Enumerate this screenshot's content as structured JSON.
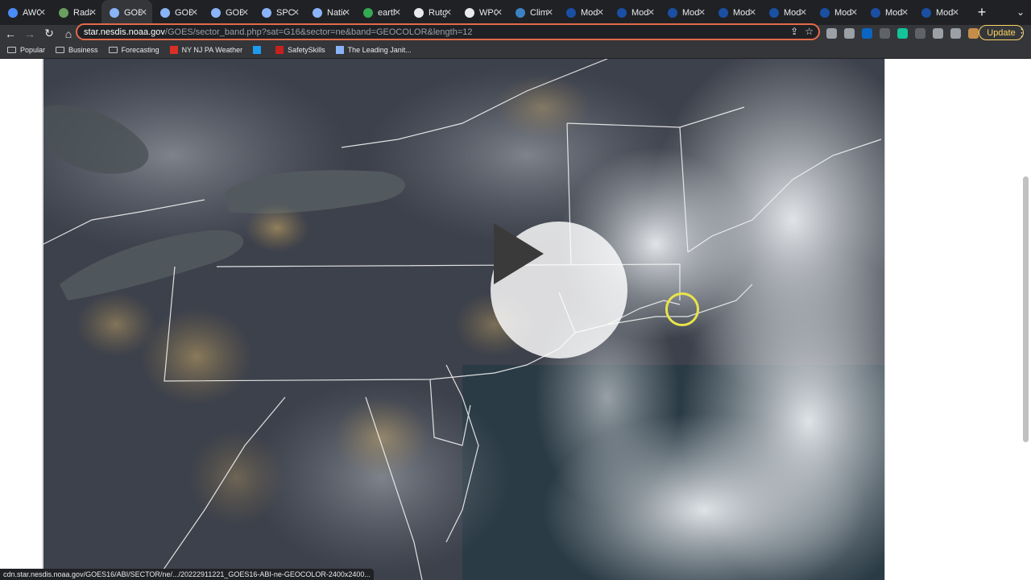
{
  "tabs": [
    {
      "label": "AWC",
      "color": "#4a8cf7"
    },
    {
      "label": "Rada",
      "color": "#6a9f5f"
    },
    {
      "label": "GOES",
      "color": "#8ab4f8",
      "active": true
    },
    {
      "label": "GOES",
      "color": "#8ab4f8"
    },
    {
      "label": "GOES",
      "color": "#8ab4f8"
    },
    {
      "label": "SPC",
      "color": "#8ab4f8"
    },
    {
      "label": "Natio",
      "color": "#8ab4f8"
    },
    {
      "label": "earth",
      "color": "#34a853"
    },
    {
      "label": "Rutge",
      "color": "#e8eaed"
    },
    {
      "label": "WPC",
      "color": "#e8eaed"
    },
    {
      "label": "Clima",
      "color": "#3b82c4"
    },
    {
      "label": "Mode",
      "color": "#1a4fa3"
    },
    {
      "label": "Mode",
      "color": "#1a4fa3"
    },
    {
      "label": "Mode",
      "color": "#1a4fa3"
    },
    {
      "label": "Mode",
      "color": "#1a4fa3"
    },
    {
      "label": "Mode",
      "color": "#1a4fa3"
    },
    {
      "label": "Mode",
      "color": "#1a4fa3"
    },
    {
      "label": "Mode",
      "color": "#1a4fa3"
    },
    {
      "label": "Mode",
      "color": "#1a4fa3"
    }
  ],
  "newtab_glyph": "+",
  "tabmenu_glyph": "⌄",
  "close_glyph": "✕",
  "nav": {
    "back": "←",
    "forward": "→",
    "reload": "↻",
    "home": "⌂"
  },
  "url": {
    "host": "star.nesdis.noaa.gov",
    "path": "/GOES/sector_band.php?sat=G16&sector=ne&band=GEOCOLOR&length=12"
  },
  "omnibox_icons": {
    "share": "⇪",
    "star": "☆"
  },
  "extensions": [
    {
      "name": "puzzle-ext",
      "color": "#9aa0a6"
    },
    {
      "name": "tab-ext",
      "color": "#9aa0a6"
    },
    {
      "name": "linkedin-ext",
      "color": "#0a66c2"
    },
    {
      "name": "sync-ext",
      "color": "#5f6368"
    },
    {
      "name": "grammarly-ext",
      "color": "#15c39a"
    },
    {
      "name": "facebook-ext",
      "color": "#5f6368"
    },
    {
      "name": "extensions-ext",
      "color": "#9aa0a6"
    },
    {
      "name": "sidepanel-ext",
      "color": "#9aa0a6"
    },
    {
      "name": "profile-ext",
      "color": "#c58d4a"
    }
  ],
  "update_label": "Update",
  "menu_glyph": "⋮",
  "bookmarks": [
    {
      "label": "Popular",
      "type": "folder"
    },
    {
      "label": "Business",
      "type": "folder"
    },
    {
      "label": "Forecasting",
      "type": "folder"
    },
    {
      "label": "NY NJ PA Weather",
      "type": "site",
      "color": "#d93025"
    },
    {
      "label": "",
      "type": "site",
      "color": "#1d9bf0"
    },
    {
      "label": "SafetySkills",
      "type": "site",
      "color": "#c5221f"
    },
    {
      "label": "The Leading Janit...",
      "type": "site",
      "color": "#8ab4f8"
    }
  ],
  "status_text": "cdn.star.nesdis.noaa.gov/GOES16/ABI/SECTOR/ne/.../20222911221_GOES16-ABI-ne-GEOCOLOR-2400x2400...",
  "colors": {
    "accent": "#e36b4a",
    "update": "#fdd663",
    "cursor_ring": "#e8e44a"
  }
}
